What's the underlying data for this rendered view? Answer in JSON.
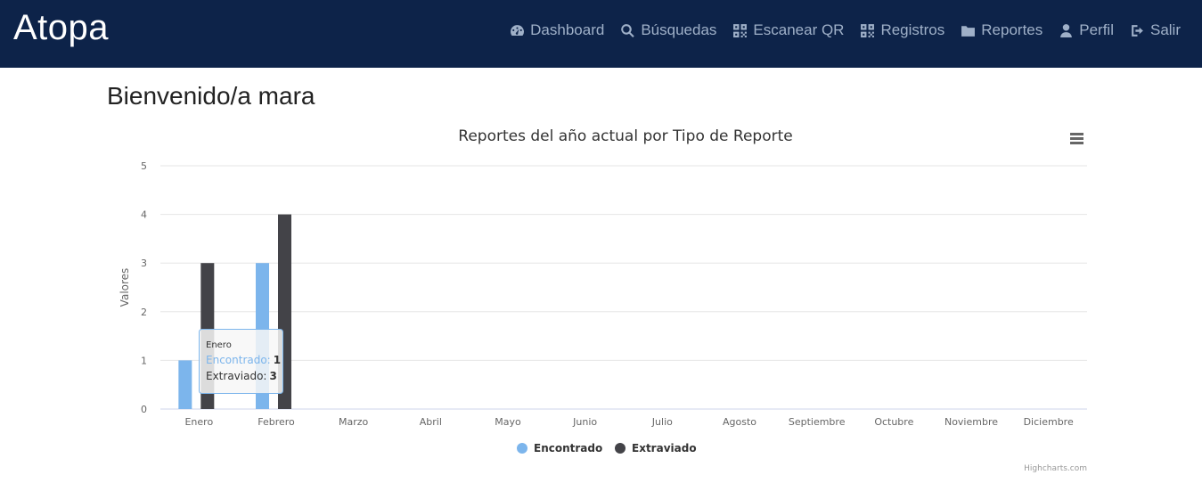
{
  "app": {
    "brand": "Atopa"
  },
  "nav": {
    "items": [
      {
        "key": "dashboard",
        "label": "Dashboard",
        "icon": "dashboard-gauge-icon"
      },
      {
        "key": "busquedas",
        "label": "Búsquedas",
        "icon": "search-icon"
      },
      {
        "key": "escanear",
        "label": "Escanear QR",
        "icon": "qr-code-icon"
      },
      {
        "key": "registros",
        "label": "Registros",
        "icon": "qr-code-icon"
      },
      {
        "key": "reportes",
        "label": "Reportes",
        "icon": "folder-icon"
      },
      {
        "key": "perfil",
        "label": "Perfil",
        "icon": "user-icon"
      },
      {
        "key": "salir",
        "label": "Salir",
        "icon": "sign-out-icon"
      }
    ]
  },
  "page": {
    "welcome": "Bienvenido/a mara"
  },
  "chart_data": {
    "type": "bar",
    "title": "Reportes del año actual por Tipo de Reporte",
    "xlabel": "",
    "ylabel": "Valores",
    "ylim": [
      0,
      5
    ],
    "yticks": [
      0,
      1,
      2,
      3,
      4,
      5
    ],
    "categories": [
      "Enero",
      "Febrero",
      "Marzo",
      "Abril",
      "Mayo",
      "Junio",
      "Julio",
      "Agosto",
      "Septiembre",
      "Octubre",
      "Noviembre",
      "Diciembre"
    ],
    "series": [
      {
        "name": "Encontrado",
        "color": "#7cb5ec",
        "values": [
          1,
          3,
          0,
          0,
          0,
          0,
          0,
          0,
          0,
          0,
          0,
          0
        ]
      },
      {
        "name": "Extraviado",
        "color": "#434348",
        "values": [
          3,
          4,
          0,
          0,
          0,
          0,
          0,
          0,
          0,
          0,
          0,
          0
        ]
      }
    ],
    "legend_position": "bottom-center",
    "grid": true,
    "credits": "Highcharts.com",
    "tooltip": {
      "category": "Enero",
      "rows": [
        {
          "series": "Encontrado",
          "value": "1"
        },
        {
          "series": "Extraviado",
          "value": "3"
        }
      ]
    }
  }
}
